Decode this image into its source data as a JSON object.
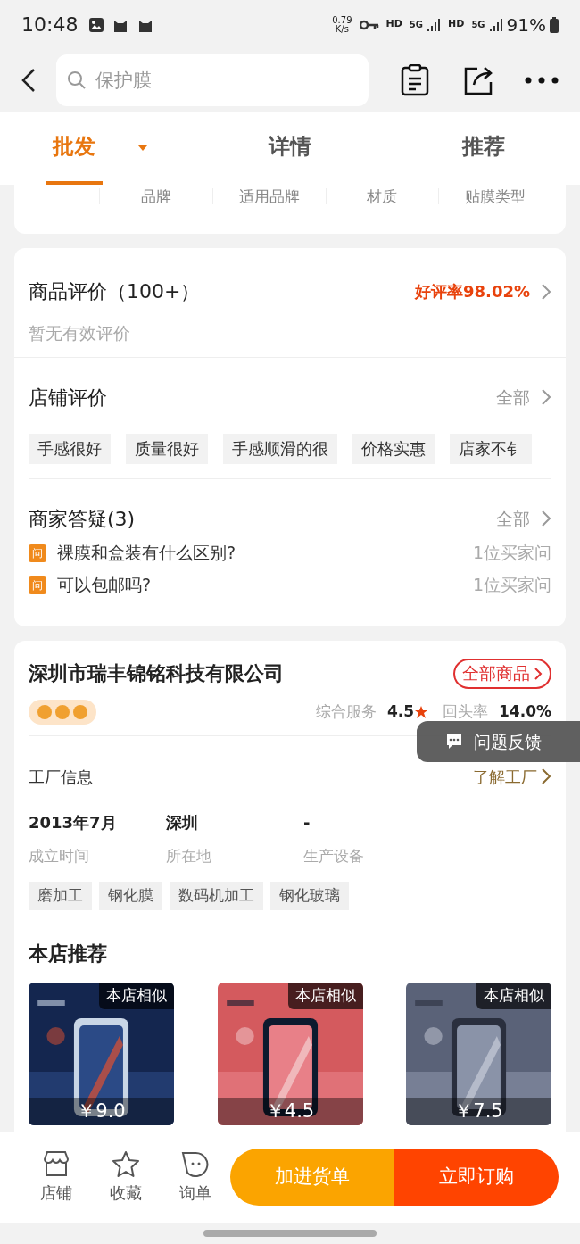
{
  "status_bar": {
    "time": "10:48",
    "speed": "0.79",
    "speed_unit": "K/s",
    "hd_1": "HD",
    "net_1": "5G",
    "hd_2": "HD",
    "net_2": "5G",
    "battery": "91%"
  },
  "header": {
    "search_placeholder": "保护膜"
  },
  "tabs": [
    {
      "label": "批发",
      "selected": true,
      "dropdown": true
    },
    {
      "label": "详情",
      "selected": false,
      "dropdown": false
    },
    {
      "label": "推荐",
      "selected": false,
      "dropdown": false
    }
  ],
  "attributes": [
    "品牌",
    "适用品牌",
    "材质",
    "贴膜类型"
  ],
  "product_reviews": {
    "title": "商品评价（100+）",
    "rate": "好评率98.02%",
    "empty": "暂无有效评价"
  },
  "shop_reviews": {
    "title": "店铺评价",
    "more": "全部",
    "tags": [
      "手感很好",
      "质量很好",
      "手感顺滑的很",
      "价格实惠",
      "店家不钅"
    ]
  },
  "qa": {
    "title": "商家答疑(3)",
    "more": "全部",
    "questions": [
      {
        "badge": "问",
        "text": "裸膜和盒装有什么区别?",
        "count": "1位买家问"
      },
      {
        "badge": "问",
        "text": "可以包邮吗?",
        "count": "1位买家问"
      }
    ]
  },
  "shop": {
    "name": "深圳市瑞丰锦铭科技有限公司",
    "all_products": "全部商品",
    "service_label": "综合服务",
    "service_score": "4.5",
    "repeat_label": "回头率",
    "repeat_rate": "14.0%",
    "factory_title": "工厂信息",
    "factory_link": "了解工厂",
    "facts": [
      {
        "value": "2013年7月",
        "label": "成立时间"
      },
      {
        "value": "深圳",
        "label": "所在地"
      },
      {
        "value": "-",
        "label": "生产设备"
      }
    ],
    "tags": [
      "磨加工",
      "钢化膜",
      "数码机加工",
      "钢化玻璃"
    ]
  },
  "recommend": {
    "title": "本店推荐",
    "items": [
      {
        "badge": "本店相似",
        "price": "￥9.0",
        "kind": "picture"
      },
      {
        "badge": "本店相似",
        "price": "￥4.5",
        "kind": "picture"
      },
      {
        "badge": "本店相似",
        "price": "￥7.5",
        "kind": "picture"
      }
    ]
  },
  "feedback": {
    "label": "问题反馈"
  },
  "bottom_bar": {
    "actions": [
      "店铺",
      "收藏",
      "询单"
    ],
    "add_button": "加进货单",
    "buy_button": "立即订购"
  }
}
